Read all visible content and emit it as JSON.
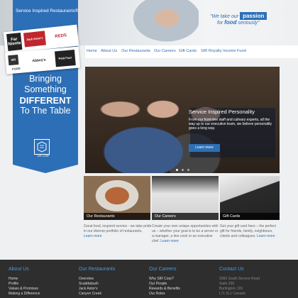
{
  "header": {
    "brand_title": "Service Inspired Restaurants®",
    "tagline_pre": "\"We take our",
    "tagline_box": "passion",
    "tagline_mid": "for",
    "tagline_food": "food",
    "tagline_post": "seriously\"",
    "brand_color": "#2d6fb6"
  },
  "logos": [
    "Far Niente",
    "Jack Astor's",
    "REDS",
    "SIR",
    "FOOD",
    "Abbey's",
    "Petit Four"
  ],
  "sidebar": {
    "line1": "Bringing",
    "line2": "Something",
    "line3": "DIFFERENT",
    "line4": "To The Table",
    "logo_label": "SIR CORP"
  },
  "nav": {
    "items": [
      "Home",
      "About Us",
      "Our Restaurants",
      "Our Careers",
      "Gift Cards",
      "SIR Royalty Income Fund"
    ]
  },
  "slide": {
    "title": "Service Inspired Personality",
    "body": "From our front-line staff and culinary experts, all the way up to our executive team, we believe personality goes a long way.",
    "button": "Learn more"
  },
  "tiles": [
    {
      "label": "Our Restaurants",
      "desc": "Great food, inspired service - we take pride in our diverse portfolio of restaurants.",
      "more": "Learn more"
    },
    {
      "label": "Our Careers",
      "desc": "Create your own unique opportunities with us – whether your goal is to be a server or a manager, a line cook or an executive chef.",
      "more": "Learn more"
    },
    {
      "label": "Gift Cards",
      "desc": "Get your gift card here – the perfect gift for friends, family, neighbours, clients and colleagues.",
      "more": "Learn more"
    }
  ],
  "footer": {
    "about": {
      "heading": "About Us",
      "links": [
        "Home",
        "Profile",
        "Values & Promises",
        "Making a Difference"
      ]
    },
    "restaurants": {
      "heading": "Our Restaurants",
      "links": [
        "Overview",
        "Scaddabush",
        "Jack Astor's",
        "Canyon Creek"
      ]
    },
    "careers": {
      "heading": "Our Careers",
      "links": [
        "Why SIR Corp?",
        "Our People",
        "Rewards & Benefits",
        "Our Roles"
      ]
    },
    "contact": {
      "heading": "Contact Us",
      "lines": [
        "5360 South Service Road",
        "Suite 200",
        "Burlington, ON",
        "L7L 5L1 Canada"
      ]
    }
  }
}
